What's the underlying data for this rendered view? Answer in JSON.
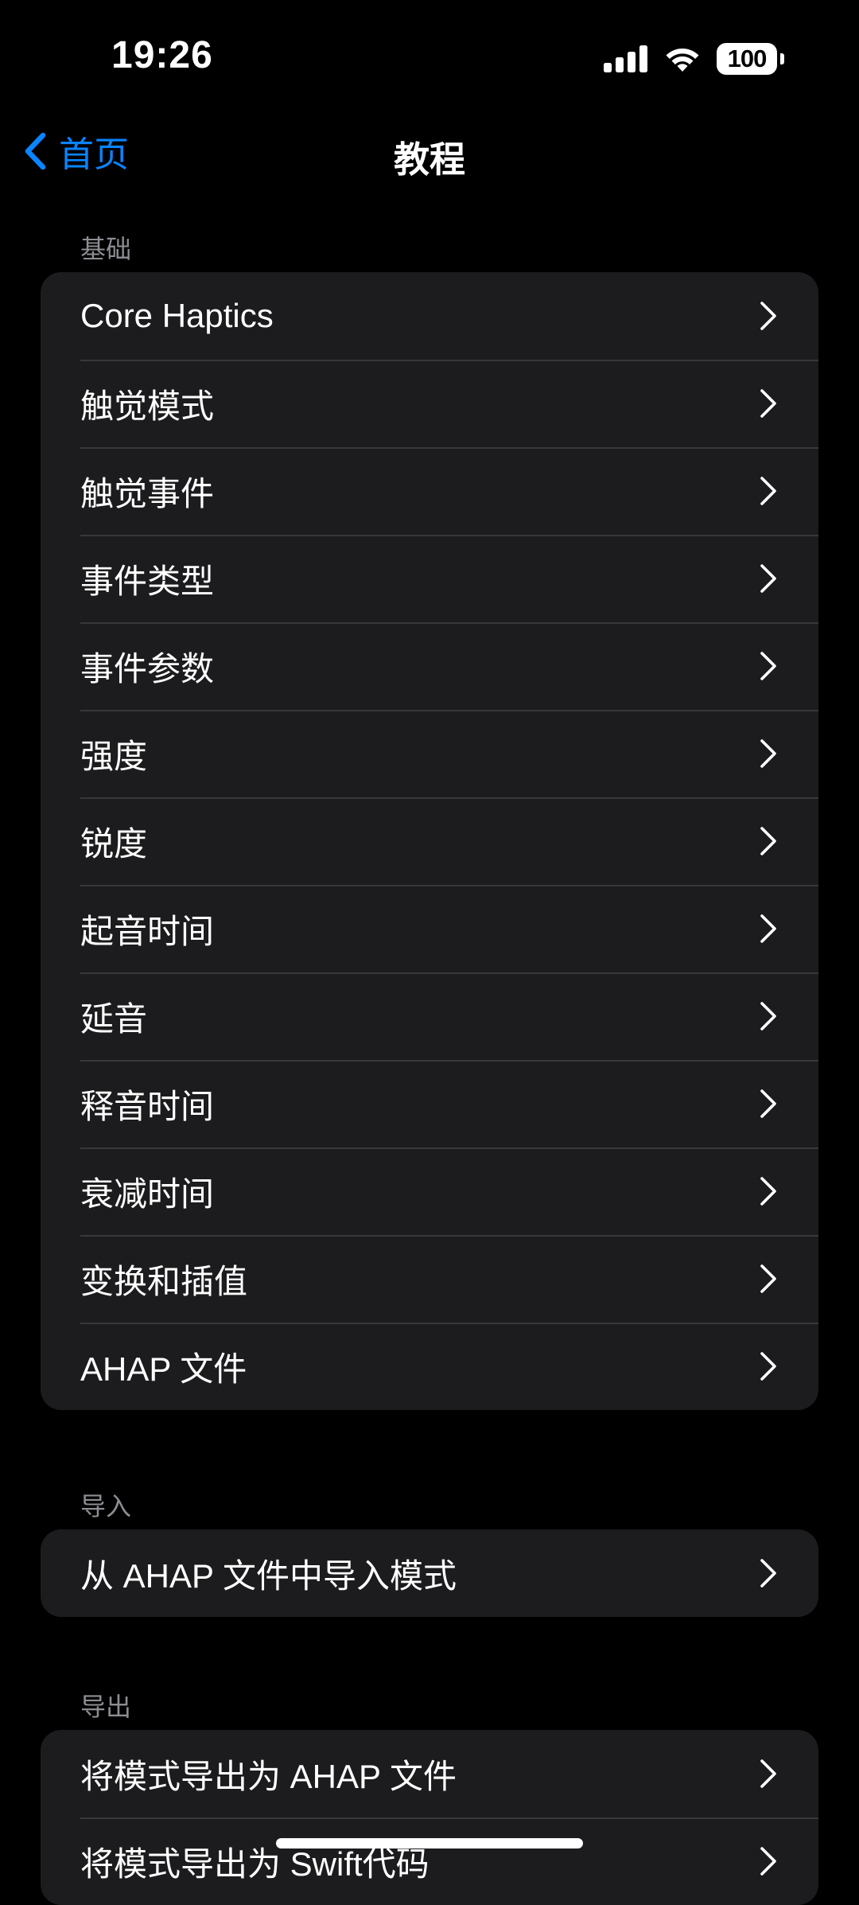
{
  "status_bar": {
    "time": "19:26",
    "battery": "100",
    "signal_icon": "cellular-signal-icon",
    "wifi_icon": "wifi-icon"
  },
  "nav": {
    "back_label": "首页",
    "title": "教程",
    "back_icon": "chevron-left-icon",
    "accent_color": "#0a84ff"
  },
  "sections": {
    "basics": {
      "header": "基础",
      "items": [
        "Core Haptics",
        "触觉模式",
        "触觉事件",
        "事件类型",
        "事件参数",
        "强度",
        "锐度",
        "起音时间",
        "延音",
        "释音时间",
        "衰减时间",
        "变换和插值",
        "AHAP 文件"
      ]
    },
    "import": {
      "header": "导入",
      "items": [
        "从 AHAP 文件中导入模式"
      ]
    },
    "export": {
      "header": "导出",
      "items": [
        "将模式导出为 AHAP 文件",
        "将模式导出为 Swift代码"
      ]
    }
  },
  "colors": {
    "background": "#000000",
    "cell": "#1c1c1e",
    "separator": "#38383a",
    "secondary_text": "#8d8d93"
  }
}
